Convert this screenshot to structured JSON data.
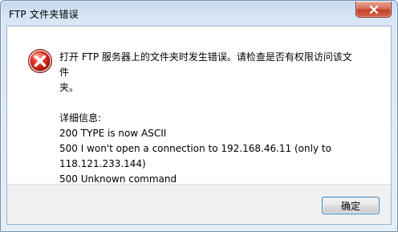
{
  "window": {
    "title": "FTP 文件夹错误"
  },
  "dialog": {
    "icon": "error-icon",
    "message_line1": "打开 FTP 服务器上的文件夹时发生错误。请检查是否有权限访问该文件",
    "message_line2": "夹。",
    "details_heading": "详细信息:",
    "details": [
      "200 TYPE is now ASCII",
      "500 I won't open a connection to 192.168.46.11 (only to",
      "118.121.233.144)",
      "500 Unknown command"
    ]
  },
  "buttons": {
    "ok_label": "确定",
    "close_icon": "close-icon"
  },
  "colors": {
    "close_button": "#c3412b",
    "error_icon": "#d0201a",
    "focus_border": "#3c7fb1"
  }
}
